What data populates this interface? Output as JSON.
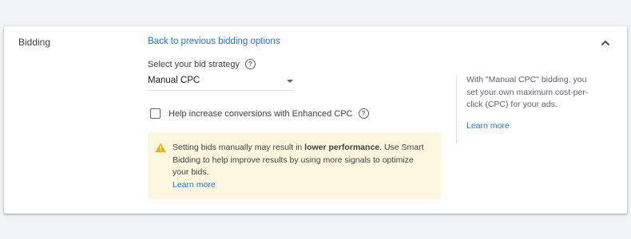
{
  "section": {
    "title": "Bidding",
    "collapse_icon": "chevron-up-icon"
  },
  "bidding": {
    "back_link": "Back to previous bidding options",
    "strategy_label": "Select your bid strategy",
    "help_icon": "help-icon",
    "strategy_value": "Manual CPC",
    "enhanced_cpc_label": "Help increase conversions with Enhanced CPC",
    "enhanced_cpc_checked": false
  },
  "warning": {
    "icon": "warning-icon",
    "text_before": "Setting bids manually may result in ",
    "text_bold": "lower performance",
    "text_after": ". Use Smart Bidding to help improve results by using more signals to optimize your bids.",
    "link": "Learn more",
    "background_color": "#fef7e0",
    "icon_color": "#f9ab00"
  },
  "side_help": {
    "text": "With \"Manual CPC\" bidding, you set your own maximum cost-per-click (CPC) for your ads.",
    "link": "Learn more"
  },
  "colors": {
    "link": "#1a73e8",
    "text": "#3c4043",
    "page_background": "#f1f3f4"
  }
}
